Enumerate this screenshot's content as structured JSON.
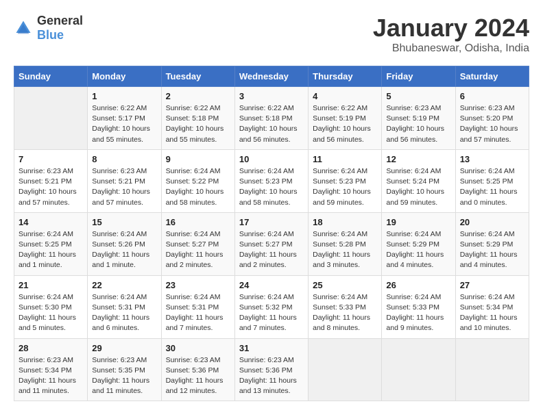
{
  "logo": {
    "text_general": "General",
    "text_blue": "Blue"
  },
  "title": "January 2024",
  "location": "Bhubaneswar, Odisha, India",
  "days_of_week": [
    "Sunday",
    "Monday",
    "Tuesday",
    "Wednesday",
    "Thursday",
    "Friday",
    "Saturday"
  ],
  "weeks": [
    [
      {
        "day": "",
        "info": ""
      },
      {
        "day": "1",
        "info": "Sunrise: 6:22 AM\nSunset: 5:17 PM\nDaylight: 10 hours\nand 55 minutes."
      },
      {
        "day": "2",
        "info": "Sunrise: 6:22 AM\nSunset: 5:18 PM\nDaylight: 10 hours\nand 55 minutes."
      },
      {
        "day": "3",
        "info": "Sunrise: 6:22 AM\nSunset: 5:18 PM\nDaylight: 10 hours\nand 56 minutes."
      },
      {
        "day": "4",
        "info": "Sunrise: 6:22 AM\nSunset: 5:19 PM\nDaylight: 10 hours\nand 56 minutes."
      },
      {
        "day": "5",
        "info": "Sunrise: 6:23 AM\nSunset: 5:19 PM\nDaylight: 10 hours\nand 56 minutes."
      },
      {
        "day": "6",
        "info": "Sunrise: 6:23 AM\nSunset: 5:20 PM\nDaylight: 10 hours\nand 57 minutes."
      }
    ],
    [
      {
        "day": "7",
        "info": "Sunrise: 6:23 AM\nSunset: 5:21 PM\nDaylight: 10 hours\nand 57 minutes."
      },
      {
        "day": "8",
        "info": "Sunrise: 6:23 AM\nSunset: 5:21 PM\nDaylight: 10 hours\nand 57 minutes."
      },
      {
        "day": "9",
        "info": "Sunrise: 6:24 AM\nSunset: 5:22 PM\nDaylight: 10 hours\nand 58 minutes."
      },
      {
        "day": "10",
        "info": "Sunrise: 6:24 AM\nSunset: 5:23 PM\nDaylight: 10 hours\nand 58 minutes."
      },
      {
        "day": "11",
        "info": "Sunrise: 6:24 AM\nSunset: 5:23 PM\nDaylight: 10 hours\nand 59 minutes."
      },
      {
        "day": "12",
        "info": "Sunrise: 6:24 AM\nSunset: 5:24 PM\nDaylight: 10 hours\nand 59 minutes."
      },
      {
        "day": "13",
        "info": "Sunrise: 6:24 AM\nSunset: 5:25 PM\nDaylight: 11 hours\nand 0 minutes."
      }
    ],
    [
      {
        "day": "14",
        "info": "Sunrise: 6:24 AM\nSunset: 5:25 PM\nDaylight: 11 hours\nand 1 minute."
      },
      {
        "day": "15",
        "info": "Sunrise: 6:24 AM\nSunset: 5:26 PM\nDaylight: 11 hours\nand 1 minute."
      },
      {
        "day": "16",
        "info": "Sunrise: 6:24 AM\nSunset: 5:27 PM\nDaylight: 11 hours\nand 2 minutes."
      },
      {
        "day": "17",
        "info": "Sunrise: 6:24 AM\nSunset: 5:27 PM\nDaylight: 11 hours\nand 2 minutes."
      },
      {
        "day": "18",
        "info": "Sunrise: 6:24 AM\nSunset: 5:28 PM\nDaylight: 11 hours\nand 3 minutes."
      },
      {
        "day": "19",
        "info": "Sunrise: 6:24 AM\nSunset: 5:29 PM\nDaylight: 11 hours\nand 4 minutes."
      },
      {
        "day": "20",
        "info": "Sunrise: 6:24 AM\nSunset: 5:29 PM\nDaylight: 11 hours\nand 4 minutes."
      }
    ],
    [
      {
        "day": "21",
        "info": "Sunrise: 6:24 AM\nSunset: 5:30 PM\nDaylight: 11 hours\nand 5 minutes."
      },
      {
        "day": "22",
        "info": "Sunrise: 6:24 AM\nSunset: 5:31 PM\nDaylight: 11 hours\nand 6 minutes."
      },
      {
        "day": "23",
        "info": "Sunrise: 6:24 AM\nSunset: 5:31 PM\nDaylight: 11 hours\nand 7 minutes."
      },
      {
        "day": "24",
        "info": "Sunrise: 6:24 AM\nSunset: 5:32 PM\nDaylight: 11 hours\nand 7 minutes."
      },
      {
        "day": "25",
        "info": "Sunrise: 6:24 AM\nSunset: 5:33 PM\nDaylight: 11 hours\nand 8 minutes."
      },
      {
        "day": "26",
        "info": "Sunrise: 6:24 AM\nSunset: 5:33 PM\nDaylight: 11 hours\nand 9 minutes."
      },
      {
        "day": "27",
        "info": "Sunrise: 6:24 AM\nSunset: 5:34 PM\nDaylight: 11 hours\nand 10 minutes."
      }
    ],
    [
      {
        "day": "28",
        "info": "Sunrise: 6:23 AM\nSunset: 5:34 PM\nDaylight: 11 hours\nand 11 minutes."
      },
      {
        "day": "29",
        "info": "Sunrise: 6:23 AM\nSunset: 5:35 PM\nDaylight: 11 hours\nand 11 minutes."
      },
      {
        "day": "30",
        "info": "Sunrise: 6:23 AM\nSunset: 5:36 PM\nDaylight: 11 hours\nand 12 minutes."
      },
      {
        "day": "31",
        "info": "Sunrise: 6:23 AM\nSunset: 5:36 PM\nDaylight: 11 hours\nand 13 minutes."
      },
      {
        "day": "",
        "info": ""
      },
      {
        "day": "",
        "info": ""
      },
      {
        "day": "",
        "info": ""
      }
    ]
  ]
}
